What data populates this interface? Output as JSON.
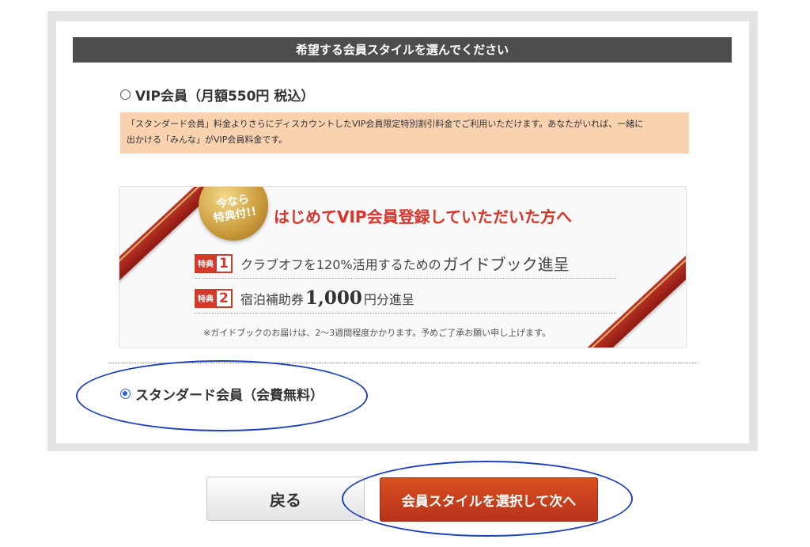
{
  "header": {
    "title": "希望する会員スタイルを選んでください"
  },
  "options": {
    "vip": {
      "label": "VIP会員（月額550円 税込）",
      "selected": false
    },
    "standard": {
      "label": "スタンダード会員（会費無料）",
      "selected": true
    }
  },
  "notice": {
    "line1": "「スタンダード会員」料金よりさらにディスカウントしたVIP会員限定特別割引料金でご利用いただけます。あなたがいれば、一緒に",
    "line2": "出かける「みんな」がVIP会員料金です。"
  },
  "promo": {
    "seal": {
      "line1": "今なら",
      "line2": "特典付!!"
    },
    "title": "はじめてVIP会員登録していただいた方へ",
    "benefits": [
      {
        "tag": "特典",
        "number": "1",
        "text": "クラブオフを120%活用するための",
        "text_large": "ガイドブック進呈"
      },
      {
        "tag": "特典",
        "number": "2",
        "text": "宿泊補助券",
        "amount": "1,000",
        "text_after": "円分進呈"
      }
    ],
    "note": "※ガイドブックのお届けは、2〜3週間程度かかります。予めご了承お願い申し上げます。"
  },
  "buttons": {
    "back": "戻る",
    "next": "会員スタイルを選択して次へ"
  },
  "colors": {
    "header_bg": "#4d4d4d",
    "notice_bg": "#f9d2b0",
    "accent_red": "#d8342a",
    "next_button": "#c8431f",
    "annotation_blue": "#1d3fc0"
  }
}
